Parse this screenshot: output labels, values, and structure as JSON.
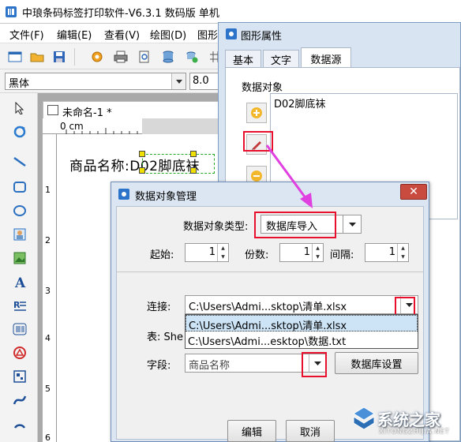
{
  "main_window": {
    "title": "中琅条码标签打印软件-V6.3.1 数码版 单机",
    "menu": [
      "文件(F)",
      "编辑(E)",
      "查看(V)",
      "绘图(D)",
      "图形"
    ],
    "font_name": "黑体",
    "font_size": "8.0",
    "doc_tab": "未命名-1 *",
    "ruler_label": "0 cm",
    "vruler_numbers": [
      "1",
      "2",
      "3",
      "4",
      "5",
      "6"
    ],
    "label_text": "商品名称:D02脚底袜"
  },
  "property_dialog": {
    "title": "图形属性",
    "tabs": [
      "基本",
      "文字",
      "数据源"
    ],
    "active_tab": 2,
    "section_label": "数据对象",
    "objects": [
      "D02脚底袜"
    ]
  },
  "data_object_dialog": {
    "title": "数据对象管理",
    "close_label": "✕",
    "type_label": "数据对象类型:",
    "type_value": "数据库导入",
    "start_label": "起始:",
    "start_value": "1",
    "copies_label": "份数:",
    "copies_value": "1",
    "interval_label": "间隔:",
    "interval_value": "1",
    "connect_label": "连接:",
    "connect_value": "C:\\Users\\Admi...sktop\\清单.xlsx",
    "connect_options": [
      "C:\\Users\\Admi...sktop\\清单.xlsx",
      "C:\\Users\\Admi...esktop\\数据.txt"
    ],
    "table_label": "表: She",
    "field_label": "字段:",
    "field_value": "商品名称",
    "db_settings_button": "数据库设置",
    "edit_button": "编辑",
    "cancel_button": "取消"
  },
  "watermark": {
    "text": "系统之家",
    "sub": "XITONGZHIJIA.NET"
  },
  "colors": {
    "highlight_red": "#e8112d",
    "arrow_magenta": "#e040e0",
    "dialog_frame": "#dbe6f2"
  }
}
